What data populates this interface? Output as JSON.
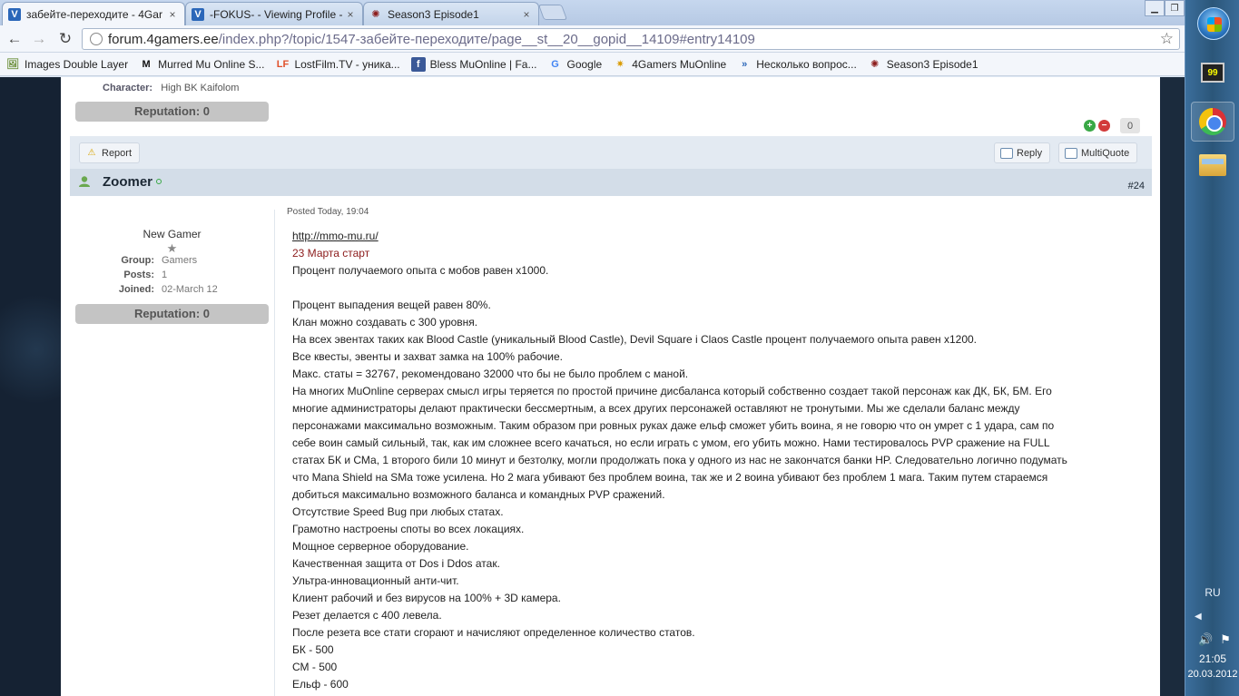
{
  "browser": {
    "tabs": [
      {
        "title": "забейте-переходите - 4Gar",
        "icon": "4gamers-favicon",
        "active": true
      },
      {
        "title": "-FOKUS- - Viewing Profile -",
        "icon": "4gamers-favicon",
        "active": false
      },
      {
        "title": "Season3 Episode1",
        "icon": "mu-favicon",
        "active": false
      }
    ],
    "close_glyph": "×",
    "window_controls": {
      "minimize": "▁",
      "restore": "❐"
    },
    "url_host": "forum.4gamers.ee",
    "url_path": "/index.php?/topic/1547-забейте-переходите/page__st__20__gopid__14109#entry14109",
    "bookmarks": [
      {
        "label": "Images Double Layer",
        "icon": "🖼",
        "color": "#6b8f3a"
      },
      {
        "label": "Murred Mu Online S...",
        "icon": "M",
        "color": "#111111"
      },
      {
        "label": "LostFilm.TV - уника...",
        "icon": "LF",
        "color": "#e0502b"
      },
      {
        "label": "Bless MuOnline | Fa...",
        "icon": "f",
        "color": "#3b5998"
      },
      {
        "label": "Google",
        "icon": "G",
        "color": "#4285f4"
      },
      {
        "label": "4Gamers MuOnline",
        "icon": "✷",
        "color": "#d99a00"
      },
      {
        "label": "Несколько вопрос...",
        "icon": "»",
        "color": "#2b67b9"
      },
      {
        "label": "Season3 Episode1",
        "icon": "✺",
        "color": "#8c1c1c"
      }
    ]
  },
  "previous_post": {
    "character_label": "Character:",
    "character_value": "High BK Kaifolom",
    "reputation": "Reputation: 0",
    "vote_count": "0"
  },
  "post_controls": {
    "report": "Report",
    "reply": "Reply",
    "multiquote": "MultiQuote"
  },
  "post": {
    "author": "Zoomer",
    "number": "#24",
    "posted": "Posted Today, 19:04",
    "rank": "New Gamer",
    "group_label": "Group:",
    "group": "Gamers",
    "posts_label": "Posts:",
    "posts": "1",
    "joined_label": "Joined:",
    "joined": "02-March 12",
    "reputation": "Reputation: 0",
    "link": "http://mmo-mu.ru/",
    "start_line": "23 Марта старт",
    "lines": [
      "Процент получаемого опыта с мобов равен x1000.",
      "",
      "Процент выпадения вещей равен 80%.",
      "Клан можно создавать с 300 уровня.",
      "На всех эвентах таких как Blood Castle (уникальный Blood Castle), Devil Square i Claos Castle процент получаемого опыта равен x1200.",
      "Все квесты, эвенты и захват замка на 100% рабочие.",
      "Макс. статы = 32767, рекомендовано 32000 что бы не было проблем с маной.",
      "На многих MuOnline серверах смысл игры теряется по простой причине дисбаланса который собственно создает такой персонаж как ДК, БК, БМ. Его",
      "многие администраторы делают практически бессмертным, а всех других персонажей оставляют не тронутыми. Мы же сделали баланс между",
      "персонажами максимально возможным. Таким образом при ровных руках даже ельф сможет убить воина, я не говорю что он умрет с 1 удара, сам по",
      "себе воин самый сильный, так, как им сложнее всего качаться, но если играть с умом, его убить можно. Нами тестировалось PVP сражение на FULL",
      "статах БК и СМа, 1 второго били 10 минут и безтолку, могли продолжать пока у одного из нас не закончатся банки HP. Следовательно логично подумать",
      "что Mana Shield на SMa тоже усилена. Но 2 мага убивают без проблем воина, так же и 2 воина убивают без проблем 1 мага. Таким путем стараемся",
      "добиться максимально возможного баланса и командных PVP сражений.",
      "Отсутствие Speed Bug при любых статах.",
      "Грамотно настроены споты во всех локациях.",
      "Мощное серверное оборудование.",
      "Качественная защита от Dos i Ddos атак.",
      "Ультра-инновационный анти-чит.",
      "Клиент рабочий и без вирусов на 100% + 3D камера.",
      "Резет делается с 400 левела.",
      "После резета все стати сгорают и начисляют определенное количество статов.",
      "БК - 500",
      "СМ - 500",
      "Ельф - 600"
    ]
  },
  "taskbar": {
    "aimp_label": "99",
    "language": "RU",
    "time": "21:05",
    "date": "20.03.2012"
  }
}
